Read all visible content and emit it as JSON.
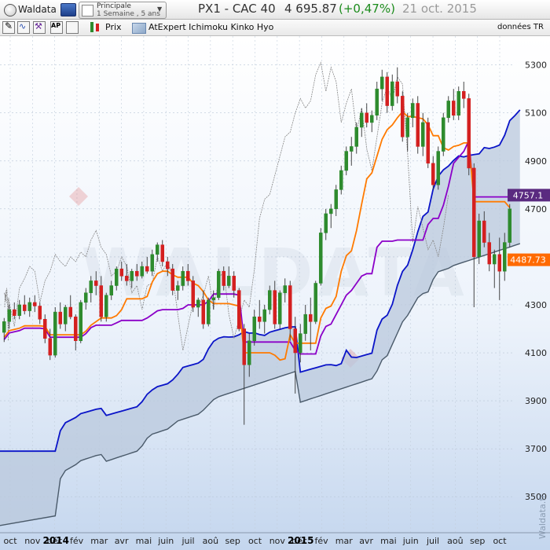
{
  "app": {
    "name": "Waldata"
  },
  "layout_selector": {
    "title": "Principale",
    "subtitle": "1 Semaine , 5 ans"
  },
  "header": {
    "symbol": "PX1 - CAC 40",
    "last": "4 695.87",
    "change": "(+0,47%)",
    "date": "21 oct. 2015"
  },
  "toolbar": {
    "prix_label": "Prix",
    "indicator_label": "AtExpert Ichimoku Kinko Hyo",
    "data_label": "données TR"
  },
  "watermark": "WALDATA",
  "vertical_credit": "Waldata.fr",
  "colors": {
    "up": "#2e8b2e",
    "down": "#d42020",
    "tenkan": "#ff7a00",
    "kijun": "#8b00c8",
    "ssa": "#0a14c8",
    "ssb": "#4a5a6a",
    "chikou": "#888888",
    "cloud": "#b9c8dc",
    "badge_kijun": "#5a2a80",
    "badge_tenkan": "#ff6a00"
  },
  "chart_data": {
    "type": "candlestick",
    "instrument": "CAC 40",
    "interval": "weekly",
    "y_axis": {
      "ticks": [
        3500,
        3700,
        3900,
        4100,
        4300,
        4500,
        4700,
        4900,
        5100,
        5300
      ],
      "ylim": [
        3350,
        5420
      ]
    },
    "x_axis": {
      "months": [
        "oct",
        "nov",
        "déc",
        "fév",
        "mar",
        "avr",
        "mai",
        "juin",
        "juil",
        "aoû",
        "sep",
        "oct",
        "nov",
        "déc",
        "fév",
        "mar",
        "avr",
        "mai",
        "juin",
        "juil",
        "aoû",
        "sep",
        "oct"
      ],
      "years": [
        "2014",
        "2015"
      ]
    },
    "last_close": 4695.87,
    "kijun_value": "4757.1",
    "tenkan_value": "4487.73",
    "candles": [
      {
        "o": 4185,
        "h": 4245,
        "l": 4145,
        "c": 4230
      },
      {
        "o": 4230,
        "h": 4300,
        "l": 4200,
        "c": 4280
      },
      {
        "o": 4280,
        "h": 4310,
        "l": 4240,
        "c": 4255
      },
      {
        "o": 4255,
        "h": 4320,
        "l": 4240,
        "c": 4300
      },
      {
        "o": 4300,
        "h": 4340,
        "l": 4260,
        "c": 4275
      },
      {
        "o": 4275,
        "h": 4330,
        "l": 4250,
        "c": 4310
      },
      {
        "o": 4310,
        "h": 4340,
        "l": 4270,
        "c": 4295
      },
      {
        "o": 4295,
        "h": 4310,
        "l": 4220,
        "c": 4240
      },
      {
        "o": 4240,
        "h": 4260,
        "l": 4140,
        "c": 4160
      },
      {
        "o": 4160,
        "h": 4200,
        "l": 4070,
        "c": 4090
      },
      {
        "o": 4090,
        "h": 4290,
        "l": 4080,
        "c": 4270
      },
      {
        "o": 4270,
        "h": 4310,
        "l": 4200,
        "c": 4220
      },
      {
        "o": 4220,
        "h": 4300,
        "l": 4190,
        "c": 4290
      },
      {
        "o": 4290,
        "h": 4340,
        "l": 4240,
        "c": 4250
      },
      {
        "o": 4250,
        "h": 4260,
        "l": 4110,
        "c": 4150
      },
      {
        "o": 4150,
        "h": 4320,
        "l": 4140,
        "c": 4310
      },
      {
        "o": 4310,
        "h": 4370,
        "l": 4280,
        "c": 4350
      },
      {
        "o": 4350,
        "h": 4420,
        "l": 4310,
        "c": 4400
      },
      {
        "o": 4400,
        "h": 4440,
        "l": 4340,
        "c": 4380
      },
      {
        "o": 4380,
        "h": 4420,
        "l": 4230,
        "c": 4250
      },
      {
        "o": 4250,
        "h": 4350,
        "l": 4230,
        "c": 4340
      },
      {
        "o": 4340,
        "h": 4400,
        "l": 4320,
        "c": 4380
      },
      {
        "o": 4380,
        "h": 4460,
        "l": 4360,
        "c": 4450
      },
      {
        "o": 4450,
        "h": 4480,
        "l": 4400,
        "c": 4420
      },
      {
        "o": 4420,
        "h": 4470,
        "l": 4380,
        "c": 4400
      },
      {
        "o": 4400,
        "h": 4450,
        "l": 4370,
        "c": 4440
      },
      {
        "o": 4440,
        "h": 4470,
        "l": 4400,
        "c": 4420
      },
      {
        "o": 4420,
        "h": 4480,
        "l": 4410,
        "c": 4460
      },
      {
        "o": 4460,
        "h": 4500,
        "l": 4430,
        "c": 4440
      },
      {
        "o": 4440,
        "h": 4530,
        "l": 4420,
        "c": 4510
      },
      {
        "o": 4510,
        "h": 4560,
        "l": 4480,
        "c": 4550
      },
      {
        "o": 4550,
        "h": 4570,
        "l": 4460,
        "c": 4480
      },
      {
        "o": 4480,
        "h": 4500,
        "l": 4420,
        "c": 4450
      },
      {
        "o": 4450,
        "h": 4470,
        "l": 4340,
        "c": 4360
      },
      {
        "o": 4360,
        "h": 4400,
        "l": 4320,
        "c": 4380
      },
      {
        "o": 4380,
        "h": 4460,
        "l": 4360,
        "c": 4440
      },
      {
        "o": 4440,
        "h": 4470,
        "l": 4380,
        "c": 4400
      },
      {
        "o": 4400,
        "h": 4420,
        "l": 4270,
        "c": 4290
      },
      {
        "o": 4290,
        "h": 4330,
        "l": 4250,
        "c": 4320
      },
      {
        "o": 4320,
        "h": 4360,
        "l": 4200,
        "c": 4220
      },
      {
        "o": 4220,
        "h": 4330,
        "l": 4210,
        "c": 4320
      },
      {
        "o": 4320,
        "h": 4360,
        "l": 4280,
        "c": 4330
      },
      {
        "o": 4330,
        "h": 4450,
        "l": 4320,
        "c": 4440
      },
      {
        "o": 4440,
        "h": 4460,
        "l": 4360,
        "c": 4380
      },
      {
        "o": 4380,
        "h": 4460,
        "l": 4370,
        "c": 4420
      },
      {
        "o": 4420,
        "h": 4440,
        "l": 4330,
        "c": 4360
      },
      {
        "o": 4360,
        "h": 4370,
        "l": 4190,
        "c": 4200
      },
      {
        "o": 4200,
        "h": 4220,
        "l": 3800,
        "c": 4050
      },
      {
        "o": 4050,
        "h": 4180,
        "l": 4000,
        "c": 4150
      },
      {
        "o": 4150,
        "h": 4280,
        "l": 4130,
        "c": 4250
      },
      {
        "o": 4250,
        "h": 4320,
        "l": 4200,
        "c": 4230
      },
      {
        "o": 4230,
        "h": 4300,
        "l": 4180,
        "c": 4280
      },
      {
        "o": 4280,
        "h": 4380,
        "l": 4260,
        "c": 4360
      },
      {
        "o": 4360,
        "h": 4400,
        "l": 4200,
        "c": 4220
      },
      {
        "o": 4220,
        "h": 4360,
        "l": 4200,
        "c": 4350
      },
      {
        "o": 4350,
        "h": 4410,
        "l": 4310,
        "c": 4380
      },
      {
        "o": 4380,
        "h": 4400,
        "l": 4150,
        "c": 4200
      },
      {
        "o": 4200,
        "h": 4250,
        "l": 3930,
        "c": 4100
      },
      {
        "o": 4100,
        "h": 4220,
        "l": 4060,
        "c": 4180
      },
      {
        "o": 4180,
        "h": 4300,
        "l": 4150,
        "c": 4260
      },
      {
        "o": 4260,
        "h": 4330,
        "l": 4110,
        "c": 4230
      },
      {
        "o": 4230,
        "h": 4400,
        "l": 4220,
        "c": 4390
      },
      {
        "o": 4390,
        "h": 4620,
        "l": 4380,
        "c": 4600
      },
      {
        "o": 4600,
        "h": 4700,
        "l": 4570,
        "c": 4680
      },
      {
        "o": 4680,
        "h": 4720,
        "l": 4620,
        "c": 4700
      },
      {
        "o": 4700,
        "h": 4800,
        "l": 4670,
        "c": 4780
      },
      {
        "o": 4780,
        "h": 4880,
        "l": 4760,
        "c": 4860
      },
      {
        "o": 4860,
        "h": 4960,
        "l": 4840,
        "c": 4940
      },
      {
        "o": 4940,
        "h": 5000,
        "l": 4880,
        "c": 4960
      },
      {
        "o": 4960,
        "h": 5060,
        "l": 4930,
        "c": 5040
      },
      {
        "o": 5040,
        "h": 5120,
        "l": 5000,
        "c": 5100
      },
      {
        "o": 5100,
        "h": 5140,
        "l": 5040,
        "c": 5060
      },
      {
        "o": 5060,
        "h": 5110,
        "l": 5020,
        "c": 5090
      },
      {
        "o": 5090,
        "h": 5230,
        "l": 5070,
        "c": 5200
      },
      {
        "o": 5200,
        "h": 5280,
        "l": 5150,
        "c": 5250
      },
      {
        "o": 5250,
        "h": 5270,
        "l": 5100,
        "c": 5130
      },
      {
        "o": 5130,
        "h": 5260,
        "l": 5110,
        "c": 5230
      },
      {
        "o": 5230,
        "h": 5290,
        "l": 5140,
        "c": 5170
      },
      {
        "o": 5170,
        "h": 5190,
        "l": 4980,
        "c": 5000
      },
      {
        "o": 5000,
        "h": 5100,
        "l": 4940,
        "c": 5080
      },
      {
        "o": 5080,
        "h": 5160,
        "l": 5040,
        "c": 5140
      },
      {
        "o": 5140,
        "h": 5170,
        "l": 4930,
        "c": 4960
      },
      {
        "o": 4960,
        "h": 5100,
        "l": 4920,
        "c": 5060
      },
      {
        "o": 5060,
        "h": 5080,
        "l": 4870,
        "c": 4890
      },
      {
        "o": 4890,
        "h": 4920,
        "l": 4780,
        "c": 4800
      },
      {
        "o": 4800,
        "h": 4960,
        "l": 4780,
        "c": 4940
      },
      {
        "o": 4940,
        "h": 5100,
        "l": 4920,
        "c": 5080
      },
      {
        "o": 5080,
        "h": 5170,
        "l": 5060,
        "c": 5150
      },
      {
        "o": 5150,
        "h": 5200,
        "l": 5070,
        "c": 5090
      },
      {
        "o": 5090,
        "h": 5210,
        "l": 5070,
        "c": 5190
      },
      {
        "o": 5190,
        "h": 5230,
        "l": 5120,
        "c": 5160
      },
      {
        "o": 5160,
        "h": 5180,
        "l": 4840,
        "c": 4870
      },
      {
        "o": 4870,
        "h": 4890,
        "l": 4290,
        "c": 4500
      },
      {
        "o": 4500,
        "h": 4680,
        "l": 4470,
        "c": 4650
      },
      {
        "o": 4650,
        "h": 4690,
        "l": 4540,
        "c": 4560
      },
      {
        "o": 4560,
        "h": 4600,
        "l": 4440,
        "c": 4470
      },
      {
        "o": 4470,
        "h": 4530,
        "l": 4370,
        "c": 4510
      },
      {
        "o": 4510,
        "h": 4580,
        "l": 4320,
        "c": 4440
      },
      {
        "o": 4440,
        "h": 4600,
        "l": 4400,
        "c": 4560
      },
      {
        "o": 4560,
        "h": 4720,
        "l": 4540,
        "c": 4700
      }
    ]
  }
}
